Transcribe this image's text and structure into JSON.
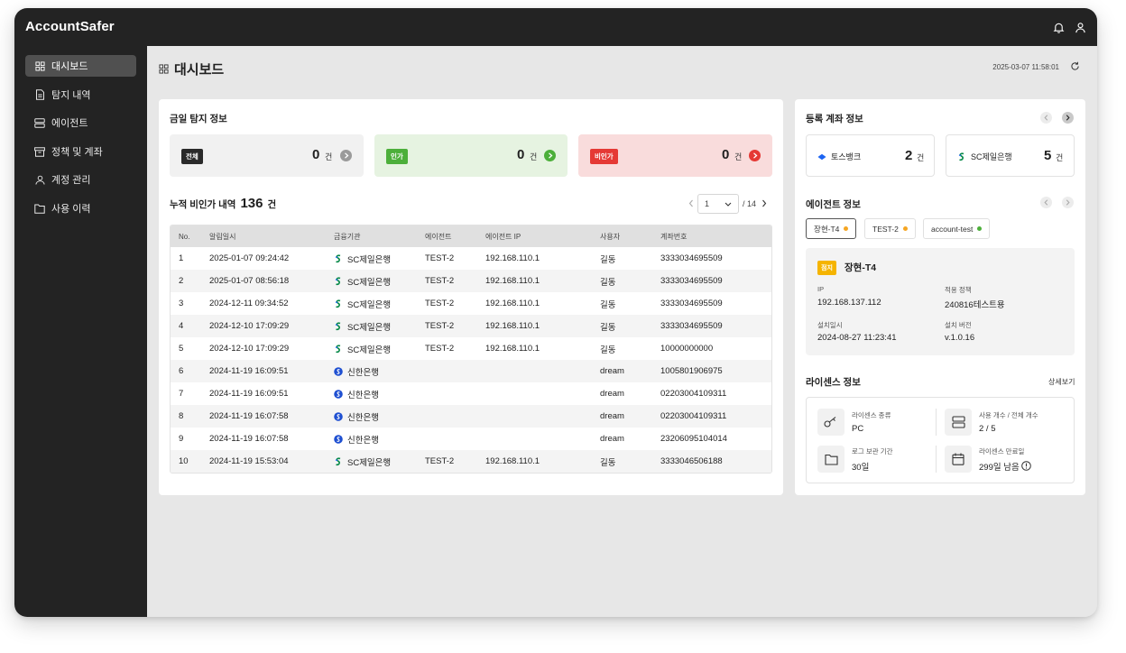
{
  "app": {
    "brand": "AccountSafer"
  },
  "sidebar": {
    "items": [
      {
        "label": "대시보드",
        "icon": "grid-icon",
        "active": true
      },
      {
        "label": "탐지 내역",
        "icon": "document-icon",
        "active": false
      },
      {
        "label": "에이전트",
        "icon": "server-icon",
        "active": false
      },
      {
        "label": "정책 및 계좌",
        "icon": "archive-icon",
        "active": false
      },
      {
        "label": "계정 관리",
        "icon": "user-icon",
        "active": false
      },
      {
        "label": "사용 이력",
        "icon": "folder-icon",
        "active": false
      }
    ]
  },
  "header": {
    "title": "대시보드",
    "datetime": "2025-03-07 11:58:01"
  },
  "today": {
    "title": "금일 탐지 정보",
    "stats": [
      {
        "tag": "전체",
        "count": "0",
        "unit": "건",
        "color": "#2a2a2a"
      },
      {
        "tag": "인가",
        "count": "0",
        "unit": "건",
        "color": "#4caf3a"
      },
      {
        "tag": "비인가",
        "count": "0",
        "unit": "건",
        "color": "#e53935"
      }
    ]
  },
  "accum": {
    "label": "누적 비인가 내역",
    "count": "136",
    "unit": "건"
  },
  "pager": {
    "page": "1",
    "total": "/ 14"
  },
  "table": {
    "headers": [
      "No.",
      "알림일시",
      "금융기관",
      "에이전트",
      "에이전트 IP",
      "사용자",
      "계좌번호"
    ],
    "rows": [
      [
        "1",
        "2025-01-07 09:24:42",
        "SC제일은행",
        "TEST-2",
        "192.168.110.1",
        "길동",
        "3333034695509"
      ],
      [
        "2",
        "2025-01-07 08:56:18",
        "SC제일은행",
        "TEST-2",
        "192.168.110.1",
        "길동",
        "3333034695509"
      ],
      [
        "3",
        "2024-12-11 09:34:52",
        "SC제일은행",
        "TEST-2",
        "192.168.110.1",
        "길동",
        "3333034695509"
      ],
      [
        "4",
        "2024-12-10 17:09:29",
        "SC제일은행",
        "TEST-2",
        "192.168.110.1",
        "길동",
        "3333034695509"
      ],
      [
        "5",
        "2024-12-10 17:09:29",
        "SC제일은행",
        "TEST-2",
        "192.168.110.1",
        "길동",
        "10000000000"
      ],
      [
        "6",
        "2024-11-19 16:09:51",
        "신한은행",
        "",
        "",
        "dream",
        "1005801906975"
      ],
      [
        "7",
        "2024-11-19 16:09:51",
        "신한은행",
        "",
        "",
        "dream",
        "02203004109311"
      ],
      [
        "8",
        "2024-11-19 16:07:58",
        "신한은행",
        "",
        "",
        "dream",
        "02203004109311"
      ],
      [
        "9",
        "2024-11-19 16:07:58",
        "신한은행",
        "",
        "",
        "dream",
        "23206095104014"
      ],
      [
        "10",
        "2024-11-19 15:53:04",
        "SC제일은행",
        "TEST-2",
        "192.168.110.1",
        "길동",
        "3333046506188"
      ]
    ]
  },
  "accounts": {
    "title": "등록 계좌 정보",
    "banks": [
      {
        "name": "토스뱅크",
        "count": "2",
        "unit": "건"
      },
      {
        "name": "SC제일은행",
        "count": "5",
        "unit": "건"
      }
    ]
  },
  "agents": {
    "title": "에이전트 정보",
    "tabs": [
      {
        "label": "장현-T4",
        "dot": "#f5a623"
      },
      {
        "label": "TEST-2",
        "dot": "#f5a623"
      },
      {
        "label": "account-test",
        "dot": "#4caf3a"
      }
    ],
    "detail": {
      "badge": "점지",
      "name": "장현-T4",
      "ip_label": "IP",
      "ip": "192.168.137.112",
      "policy_label": "적용 정책",
      "policy": "240816테스트용",
      "installed_label": "설치일시",
      "installed": "2024-08-27 11:23:41",
      "version_label": "설치 버전",
      "version": "v.1.0.16"
    }
  },
  "license": {
    "title": "라이센스 정보",
    "detail_link": "상세보기",
    "items": [
      {
        "label": "라이센스 종류",
        "value": "PC",
        "icon": "key-icon"
      },
      {
        "label": "사용 개수 / 전체 개수",
        "value": "2 / 5",
        "icon": "server-icon"
      },
      {
        "label": "로그 보관 기간",
        "value": "30일",
        "icon": "folder-icon"
      },
      {
        "label": "라이센스 만료일",
        "value": "299일 남음",
        "icon": "calendar-icon"
      }
    ]
  },
  "colors": {
    "sidebar": "#232323",
    "background": "#e7e7e7",
    "sc_bank": "#0a8a4a",
    "shinhan": "#1e4fd1",
    "toss": "#1c64f2"
  }
}
